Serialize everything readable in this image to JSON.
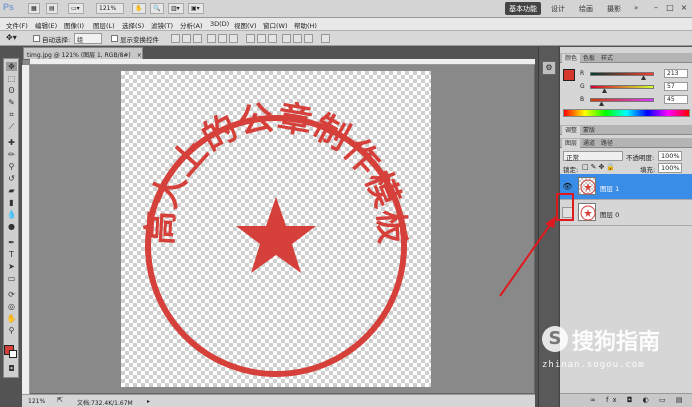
{
  "app": {
    "logo": "Ps",
    "zoom_select": "121%",
    "workspaces": [
      "基本功能",
      "设计",
      "绘画",
      "摄影"
    ],
    "active_workspace": "基本功能",
    "overflow": "»"
  },
  "menu": [
    "文件(F)",
    "编辑(E)",
    "图像(I)",
    "图层(L)",
    "选择(S)",
    "滤镜(T)",
    "分析(A)",
    "3D(D)",
    "视图(V)",
    "窗口(W)",
    "帮助(H)"
  ],
  "options": {
    "auto_select_label": "自动选择:",
    "auto_select_value": "组",
    "show_transform_label": "显示变换控件"
  },
  "document": {
    "tab_title": "timg.jpg @ 121% (图层 1, RGB/8#)",
    "close": "×",
    "status_zoom": "121%",
    "status_doc": "文档:732.4K/1.67M"
  },
  "stamp": {
    "text": "高大上的公章制作模板",
    "color": "#d6403a"
  },
  "color_panel": {
    "tabs": [
      "颜色",
      "色板",
      "样式"
    ],
    "channels": [
      {
        "name": "R",
        "value": "213",
        "fraction": 0.835
      },
      {
        "name": "G",
        "value": "57",
        "fraction": 0.224
      },
      {
        "name": "B",
        "value": "45",
        "fraction": 0.176
      }
    ],
    "swatch_color": "#d5392d"
  },
  "adjust_tabs": [
    "调整",
    "蒙版"
  ],
  "layers_panel": {
    "tabs": [
      "图层",
      "通道",
      "路径"
    ],
    "blend_mode": "正常",
    "opacity_label": "不透明度:",
    "opacity_value": "100%",
    "lock_label": "锁定:",
    "fill_label": "填充:",
    "fill_value": "100%",
    "layers": [
      {
        "name": "图层 1",
        "visible": true,
        "selected": true
      },
      {
        "name": "图层 0",
        "visible": false,
        "selected": false
      }
    ]
  },
  "annotation": {
    "color": "#e0191e"
  },
  "watermark": {
    "brand": "搜狗指南",
    "url": "zhinan.sogou.com"
  }
}
